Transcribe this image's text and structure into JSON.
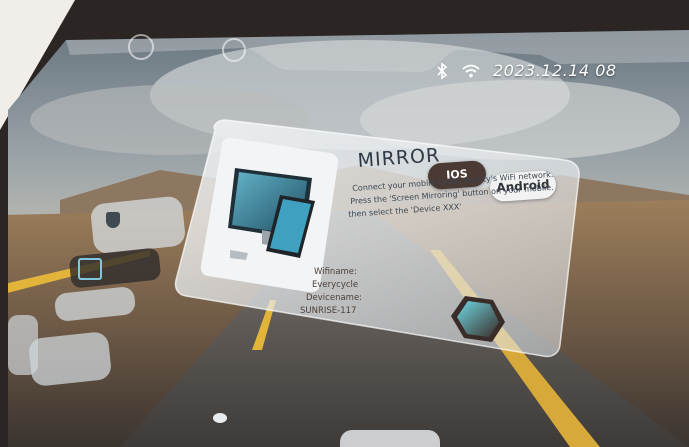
{
  "status": {
    "datetime": "2023.12.14 08",
    "icons": [
      "bluetooth-icon",
      "wifi-icon"
    ]
  },
  "mirror": {
    "title": "MIRROR",
    "tabs": {
      "ios": "IOS",
      "android": "Android"
    },
    "instructions": [
      "Connect your mobile to the facility's WiFi network.",
      "Press the 'Screen Mirroring' button on your mobile.",
      "then select the 'Device XXX'"
    ],
    "wifi_label": "Wifiname:",
    "wifi_value": "Everycycle",
    "device_label": "Devicename:",
    "device_value": "SUNRISE-117"
  },
  "colors": {
    "ios_bg": "#4a3a33",
    "android_bg": "#f2f2f2",
    "card_glass": "#e8ecef",
    "road_line": "#e2b43a"
  }
}
